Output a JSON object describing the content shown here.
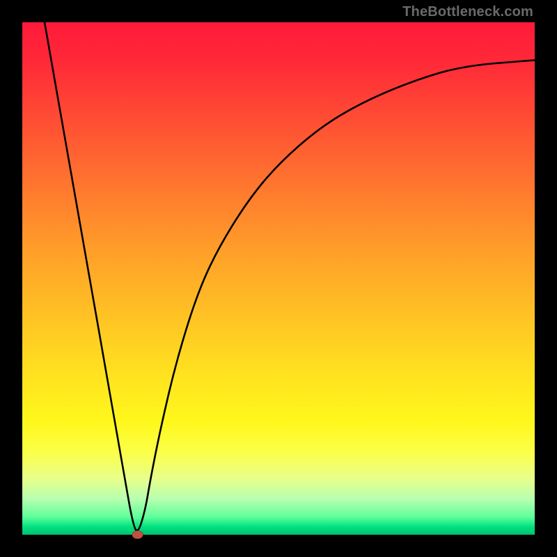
{
  "watermark": "TheBottleneck.com",
  "chart_data": {
    "type": "line",
    "title": "",
    "xlabel": "",
    "ylabel": "",
    "xlim": [
      0,
      100
    ],
    "ylim": [
      0,
      100
    ],
    "grid": false,
    "legend": false,
    "background_gradient": {
      "top": "#ff1a3a",
      "mid": "#ffd020",
      "bottom": "#00c070"
    },
    "series": [
      {
        "name": "bottleneck-curve",
        "color": "#000000",
        "x": [
          4.35,
          6,
          8,
          10,
          12,
          14,
          16,
          18,
          20,
          21.5,
          22.5,
          24,
          25,
          27,
          30,
          34,
          38,
          44,
          50,
          58,
          66,
          76,
          86,
          100
        ],
        "y": [
          100,
          90.6,
          79.2,
          67.9,
          56.5,
          45.2,
          33.8,
          22.4,
          11.0,
          2.5,
          0.0,
          4.8,
          10.8,
          20.8,
          33.6,
          46.6,
          55.5,
          65.2,
          72.4,
          79.4,
          84.2,
          88.5,
          91.5,
          92.6
        ]
      }
    ],
    "marker": {
      "name": "optimal-point",
      "x": 22.5,
      "y": 0,
      "color": "#c05040",
      "rx": 8,
      "ry": 6
    }
  }
}
